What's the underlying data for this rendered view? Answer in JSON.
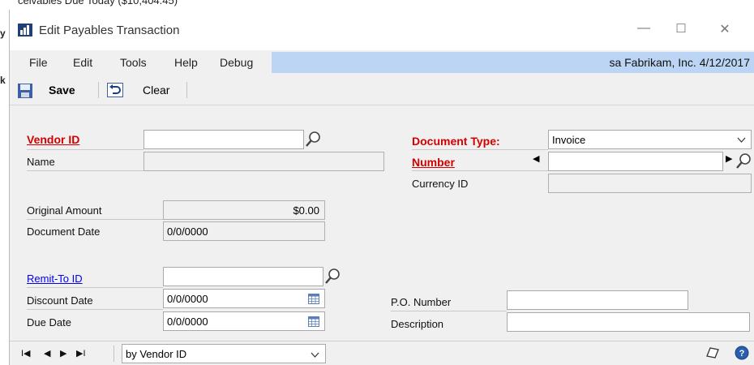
{
  "background": {
    "partial_text": "ceivables Due Today  ($10,404.45)",
    "left_char_1": "y",
    "left_char_2": "k"
  },
  "window": {
    "title": "Edit Payables Transaction",
    "controls": {
      "minimize": "—",
      "maximize": "☐",
      "close": "✕"
    }
  },
  "menu": {
    "items": [
      "File",
      "Edit",
      "Tools",
      "Help",
      "Debug"
    ],
    "status": "sa  Fabrikam, Inc.  4/12/2017"
  },
  "toolbar": {
    "save_label": "Save",
    "clear_label": "Clear"
  },
  "form": {
    "vendor_id_label": "Vendor ID",
    "vendor_id_value": "",
    "name_label": "Name",
    "name_value": "",
    "document_type_label": "Document Type:",
    "document_type_value": "Invoice",
    "number_label": "Number",
    "number_value": "",
    "currency_id_label": "Currency ID",
    "currency_id_value": "",
    "original_amount_label": "Original Amount",
    "original_amount_value": "$0.00",
    "document_date_label": "Document Date",
    "document_date_value": "0/0/0000",
    "remit_to_label": "Remit-To ID",
    "remit_to_value": "",
    "discount_date_label": "Discount Date",
    "discount_date_value": "0/0/0000",
    "due_date_label": "Due Date",
    "due_date_value": "0/0/0000",
    "po_number_label": "P.O. Number",
    "po_number_value": "",
    "description_label": "Description",
    "description_value": ""
  },
  "footer": {
    "sort_value": "by Vendor ID",
    "nav": {
      "first": "I◀",
      "prev": "◀",
      "next": "▶",
      "last": "▶I"
    }
  },
  "colors": {
    "required": "#d40000",
    "link": "#0000ee",
    "status_bar": "#bcd5f5",
    "panel": "#f0f0f0"
  }
}
